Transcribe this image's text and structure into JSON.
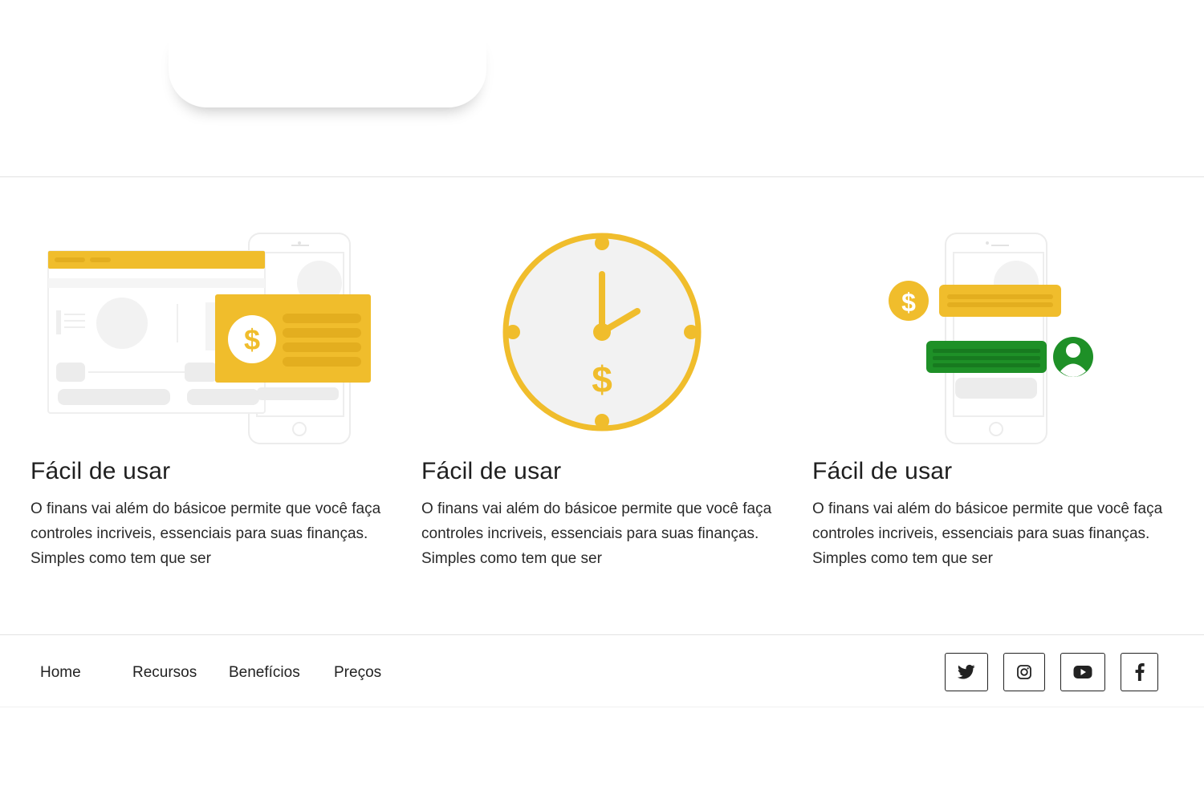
{
  "features": [
    {
      "title": "Fácil de usar",
      "text": "O finans vai além do básicoe permite que você faça controles incriveis, essenciais para suas finanças. Simples como tem que ser"
    },
    {
      "title": "Fácil de usar",
      "text": "O finans vai além do básicoe permite que você faça controles incriveis, essenciais para suas finanças. Simples como tem que ser"
    },
    {
      "title": "Fácil de usar",
      "text": "O finans vai além do básicoe permite que você faça controles incriveis, essenciais para suas finanças. Simples como tem que ser"
    }
  ],
  "illustrations": {
    "currency_symbol": "$",
    "yellow": "#f0bd2c",
    "green": "#1e9027",
    "gray": "#f2f2f2"
  },
  "footer": {
    "nav": [
      "Home",
      "Recursos",
      "Benefícios",
      "Preços"
    ],
    "social": [
      "twitter-icon",
      "instagram-icon",
      "youtube-icon",
      "facebook-icon"
    ]
  }
}
